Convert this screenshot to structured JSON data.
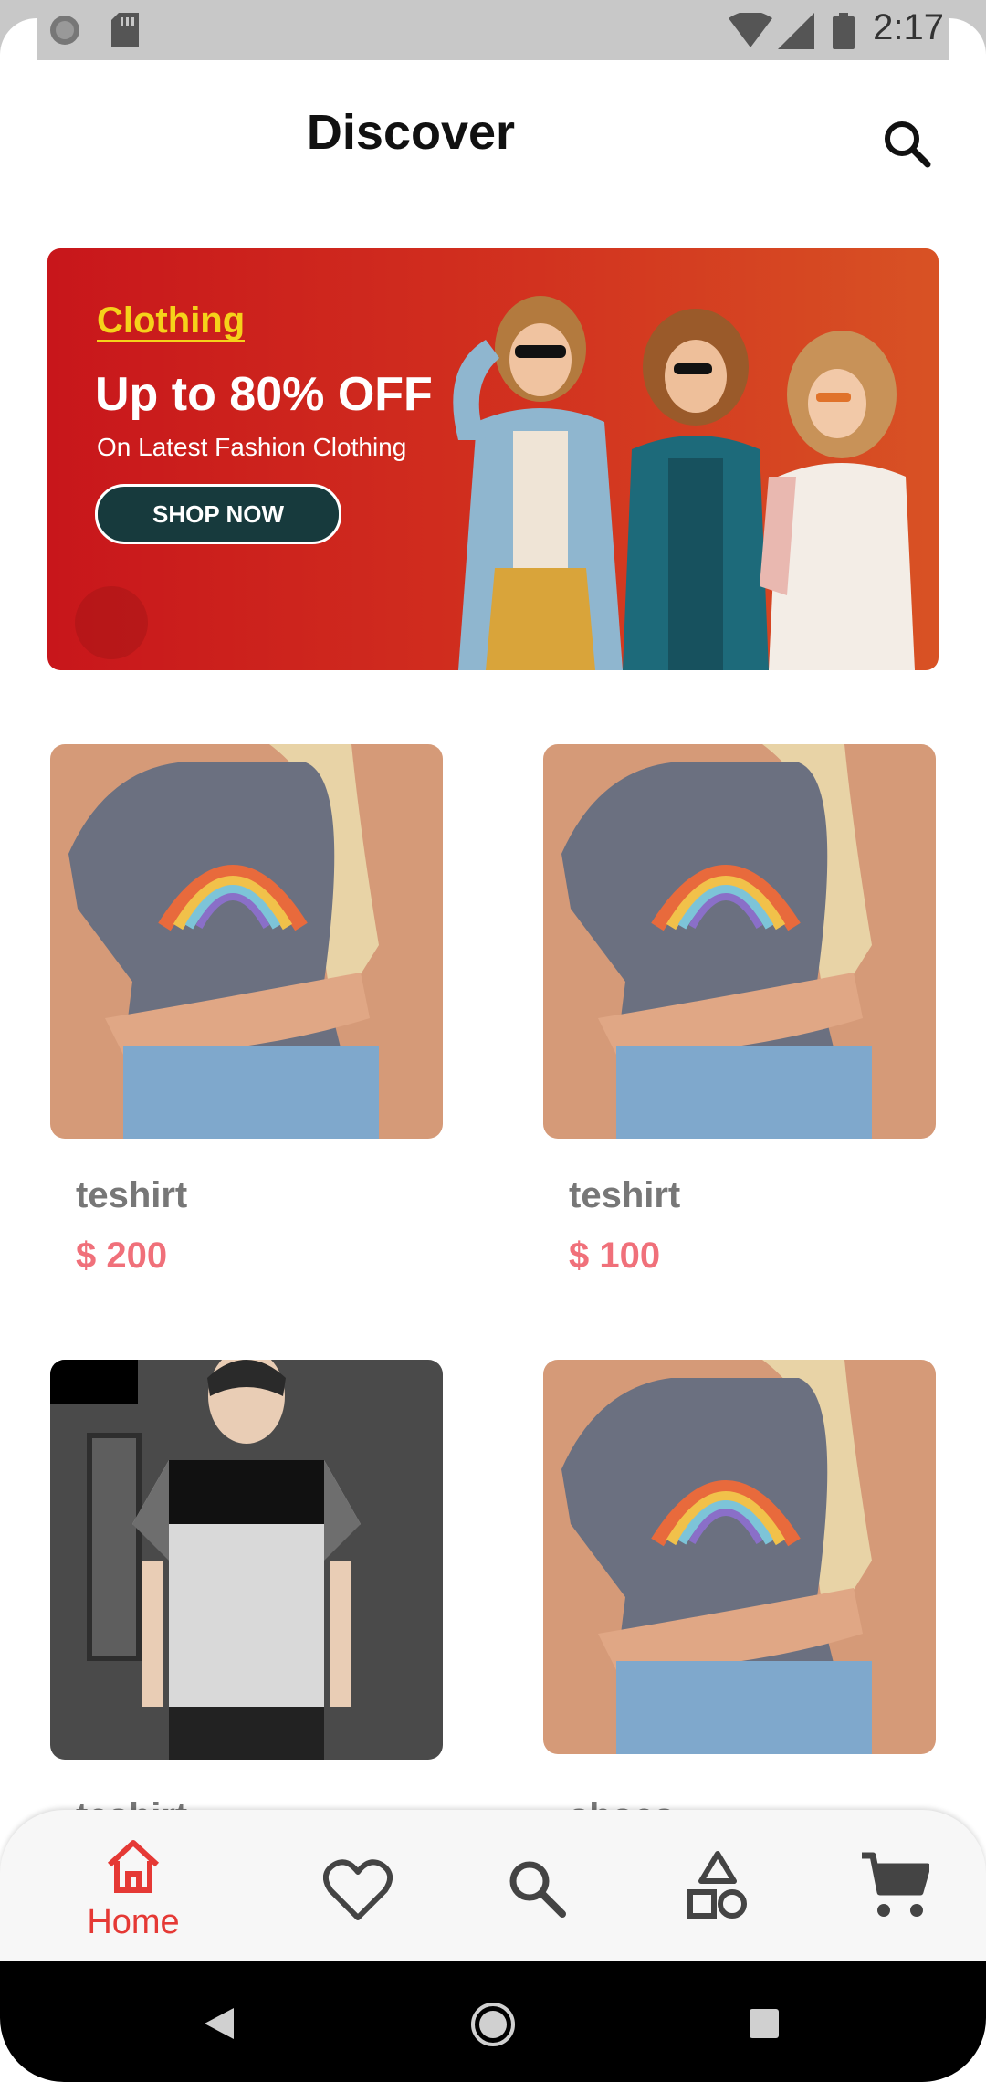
{
  "status_bar": {
    "time": "2:17"
  },
  "header": {
    "title": "Discover"
  },
  "banner": {
    "category": "Clothing",
    "offer": "Up to 80% OFF",
    "subtitle": "On Latest Fashion Clothing",
    "cta": "SHOP NOW"
  },
  "products": [
    {
      "name": "teshirt",
      "price": "$ 200"
    },
    {
      "name": "teshirt",
      "price": "$ 100"
    },
    {
      "name": "teshirt",
      "price": ""
    },
    {
      "name": "shoes",
      "price": ""
    }
  ],
  "bottom_nav": {
    "items": [
      {
        "label": "Home",
        "icon": "home-icon",
        "active": true
      },
      {
        "label": "",
        "icon": "heart-icon",
        "active": false
      },
      {
        "label": "",
        "icon": "search-icon",
        "active": false
      },
      {
        "label": "",
        "icon": "categories-icon",
        "active": false
      },
      {
        "label": "",
        "icon": "cart-icon",
        "active": false
      }
    ]
  },
  "colors": {
    "accent": "#e53935",
    "price": "#f0707a",
    "banner": "#c8161b"
  }
}
